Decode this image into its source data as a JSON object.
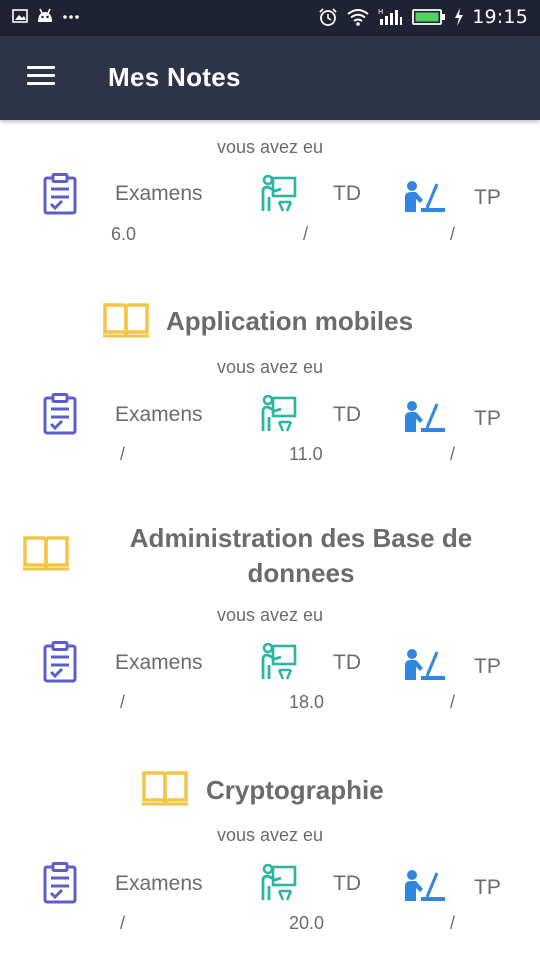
{
  "status_bar": {
    "time": "19:15",
    "icons": [
      "image-icon",
      "android-icon",
      "more-icon",
      "alarm-icon",
      "wifi-icon",
      "signal-icon",
      "battery-icon",
      "charging-icon"
    ]
  },
  "app_bar": {
    "title": "Mes Notes",
    "menu_icon": "menu-icon"
  },
  "colors": {
    "status_bar_bg": "#1e2232",
    "app_bar_bg": "#2e3448",
    "exam_icon": "#5b5fc7",
    "td_icon": "#2bb5a3",
    "tp_icon": "#2f87e0",
    "book_icon": "#f2c549",
    "text": "#6b6b6b"
  },
  "courses": [
    {
      "title": "",
      "subtitle": "vous avez eu",
      "labels": {
        "exam": "Examens",
        "td": "TD",
        "tp": "TP"
      },
      "values": {
        "exam": "6.0",
        "td": "/",
        "tp": "/"
      }
    },
    {
      "title": "Application mobiles",
      "subtitle": "vous avez eu",
      "labels": {
        "exam": "Examens",
        "td": "TD",
        "tp": "TP"
      },
      "values": {
        "exam": "/",
        "td": "11.0",
        "tp": "/"
      }
    },
    {
      "title_line1": "Administration des Base de",
      "title_line2": "donnees",
      "subtitle": "vous avez eu",
      "labels": {
        "exam": "Examens",
        "td": "TD",
        "tp": "TP"
      },
      "values": {
        "exam": "/",
        "td": "18.0",
        "tp": "/"
      }
    },
    {
      "title": "Cryptographie",
      "subtitle": "vous avez eu",
      "labels": {
        "exam": "Examens",
        "td": "TD",
        "tp": "TP"
      },
      "values": {
        "exam": "/",
        "td": "20.0",
        "tp": "/"
      }
    }
  ]
}
